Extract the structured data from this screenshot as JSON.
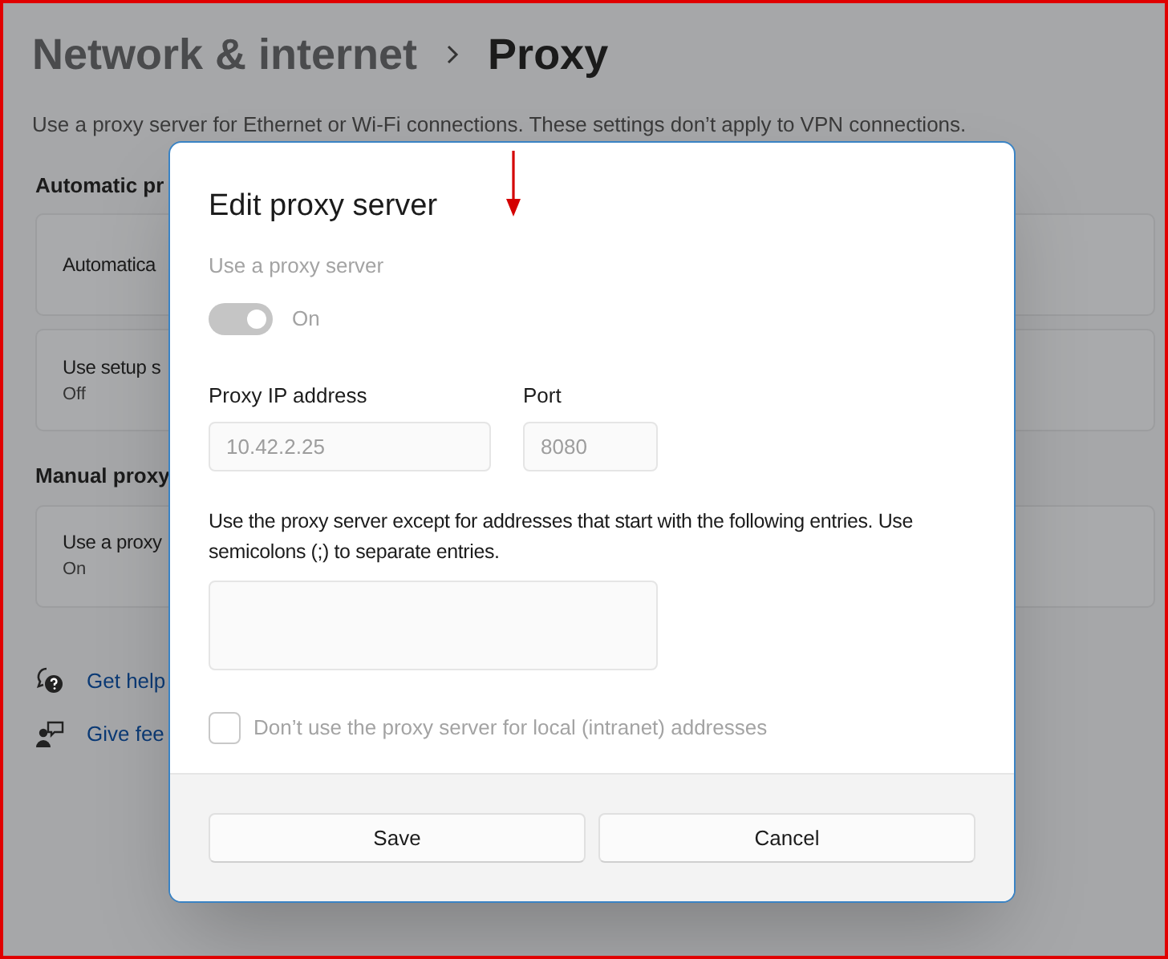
{
  "breadcrumb": {
    "parent": "Network & internet",
    "current": "Proxy"
  },
  "description": "Use a proxy server for Ethernet or Wi-Fi connections. These settings don’t apply to VPN connections.",
  "sections": [
    {
      "heading": "Automatic pr",
      "cards": [
        {
          "title": "Automatica"
        },
        {
          "title": "Use setup s",
          "status": "Off"
        }
      ]
    },
    {
      "heading": "Manual proxy",
      "cards": [
        {
          "title": "Use a proxy",
          "status": "On"
        }
      ]
    }
  ],
  "links": [
    {
      "kind": "help",
      "label": "Get help"
    },
    {
      "kind": "feedback",
      "label": "Give fee"
    }
  ],
  "dialog": {
    "title": "Edit proxy server",
    "toggle": {
      "label": "Use a proxy server",
      "on": true,
      "disabled": true,
      "state_text": "On"
    },
    "fields": [
      {
        "label": "Proxy IP address",
        "value": "10.42.2.25",
        "disabled": true
      },
      {
        "label": "Port",
        "value": "8080",
        "disabled": true
      }
    ],
    "exceptions_text": "Use the proxy server except for addresses that start with the following entries. Use semicolons (;) to separate entries.",
    "checkbox": {
      "label": "Don’t use the proxy server for local (intranet) addresses",
      "checked": false,
      "disabled": true
    },
    "buttons": [
      "Save",
      "Cancel"
    ]
  }
}
